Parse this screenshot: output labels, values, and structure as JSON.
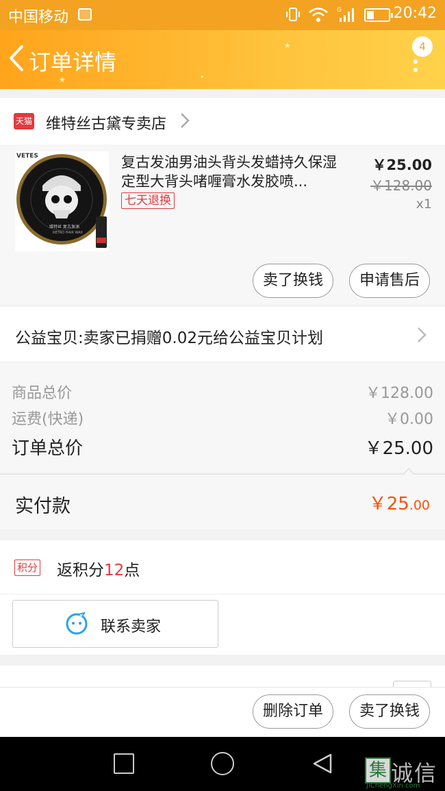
{
  "status_bar": {
    "carrier": "中国移动",
    "time": "20:42",
    "network": "G"
  },
  "nav": {
    "title": "订单详情",
    "badge": "4"
  },
  "store": {
    "platform_tag": "天猫",
    "name": "维特丝古黛专卖店"
  },
  "product": {
    "title": "复古发油男油头背头发蜡持久保湿定型大背头啫喱膏水发胶喷...",
    "tag": "七天退换",
    "price": "￥25.00",
    "original_price": "￥128.00",
    "quantity": "x1",
    "image_brand": "VETES",
    "image_caption_cn": "维特丝 复古发油",
    "image_caption_en": "RETRO HAIR WAX"
  },
  "item_actions": {
    "sell_label": "卖了换钱",
    "aftersale_label": "申请售后"
  },
  "charity": {
    "text": "公益宝贝:卖家已捐赠0.02元给公益宝贝计划"
  },
  "summary": {
    "goods_total_label": "商品总价",
    "goods_total_value": "￥128.00",
    "shipping_label": "运费(快递)",
    "shipping_value": "￥0.00",
    "order_total_label": "订单总价",
    "order_total_value": "￥25.00"
  },
  "paid": {
    "label": "实付款",
    "currency": "￥",
    "int": "25",
    "dec": ".00"
  },
  "points": {
    "tag": "积分",
    "text_prefix": "返积分",
    "number": "12",
    "text_suffix": "点"
  },
  "contact": {
    "label": "联系卖家"
  },
  "bottom_actions": {
    "delete_label": "删除订单",
    "sell_label": "卖了换钱"
  },
  "watermark": {
    "mark": "集",
    "text": "诚信",
    "url": "JiChengXin.com"
  },
  "colors": {
    "accent": "#f3a321",
    "price_orange": "#ff5000",
    "tag_red": "#e4393c"
  }
}
